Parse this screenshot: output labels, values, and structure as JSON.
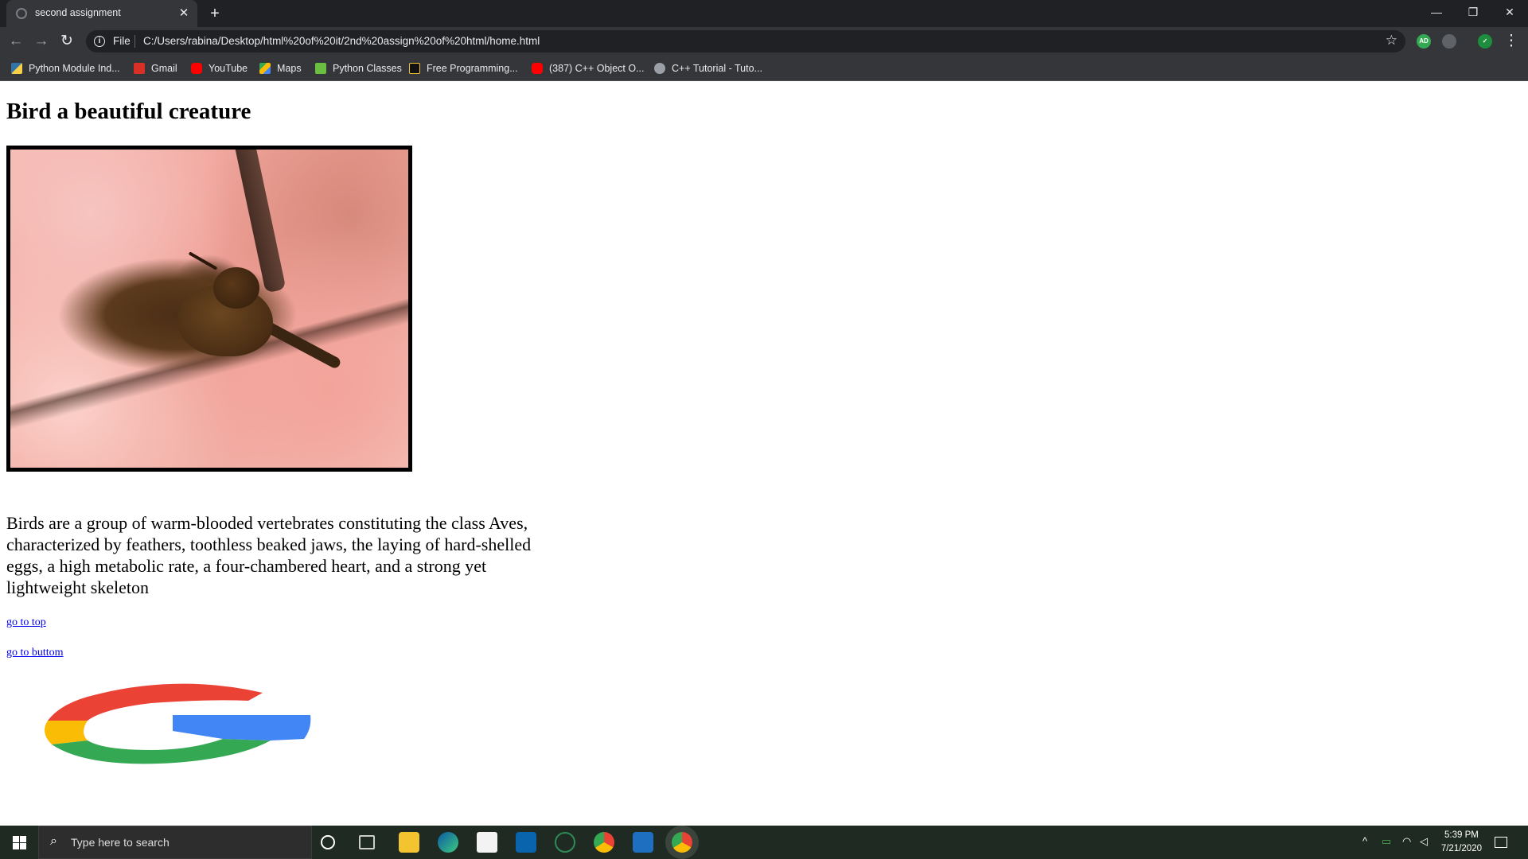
{
  "browser": {
    "tab": {
      "title": "second assignment",
      "favicon": "globe-icon"
    },
    "toolbar": {
      "scheme": "File",
      "url": "C:/Users/rabina/Desktop/html%20of%20it/2nd%20assign%20of%20html/home.html"
    },
    "bookmarks": [
      {
        "label": "Python Module Ind...",
        "color": "#3572A5"
      },
      {
        "label": "Gmail",
        "color": "#d93025"
      },
      {
        "label": "YouTube",
        "color": "#ff0000"
      },
      {
        "label": "Maps",
        "color": "#34a853"
      },
      {
        "label": "Python Classes",
        "color": "#6abf40"
      },
      {
        "label": "Free Programming...",
        "color": "#f1c232"
      },
      {
        "label": "(387) C++ Object O...",
        "color": "#ff0000"
      },
      {
        "label": "C++ Tutorial - Tuto...",
        "color": "#9aa0a6"
      }
    ],
    "extensions": [
      {
        "label": "AD",
        "color": "#34a853"
      },
      {
        "label": "",
        "color": "#9aa0a6"
      },
      {
        "label": "",
        "color": "#1e8e3e"
      }
    ]
  },
  "page": {
    "title": "Bird a beautiful creature",
    "description": "Birds are a group of warm-blooded vertebrates constituting the class Aves, characterized by feathers, toothless beaked jaws, the laying of hard-shelled eggs, a high metabolic rate, a four-chambered heart, and a strong yet lightweight skeleton",
    "link_top": "go to top",
    "link_bottom": "go to buttom"
  },
  "taskbar": {
    "search_placeholder": "Type here to search",
    "time": "5:39 PM",
    "date": "7/21/2020"
  }
}
